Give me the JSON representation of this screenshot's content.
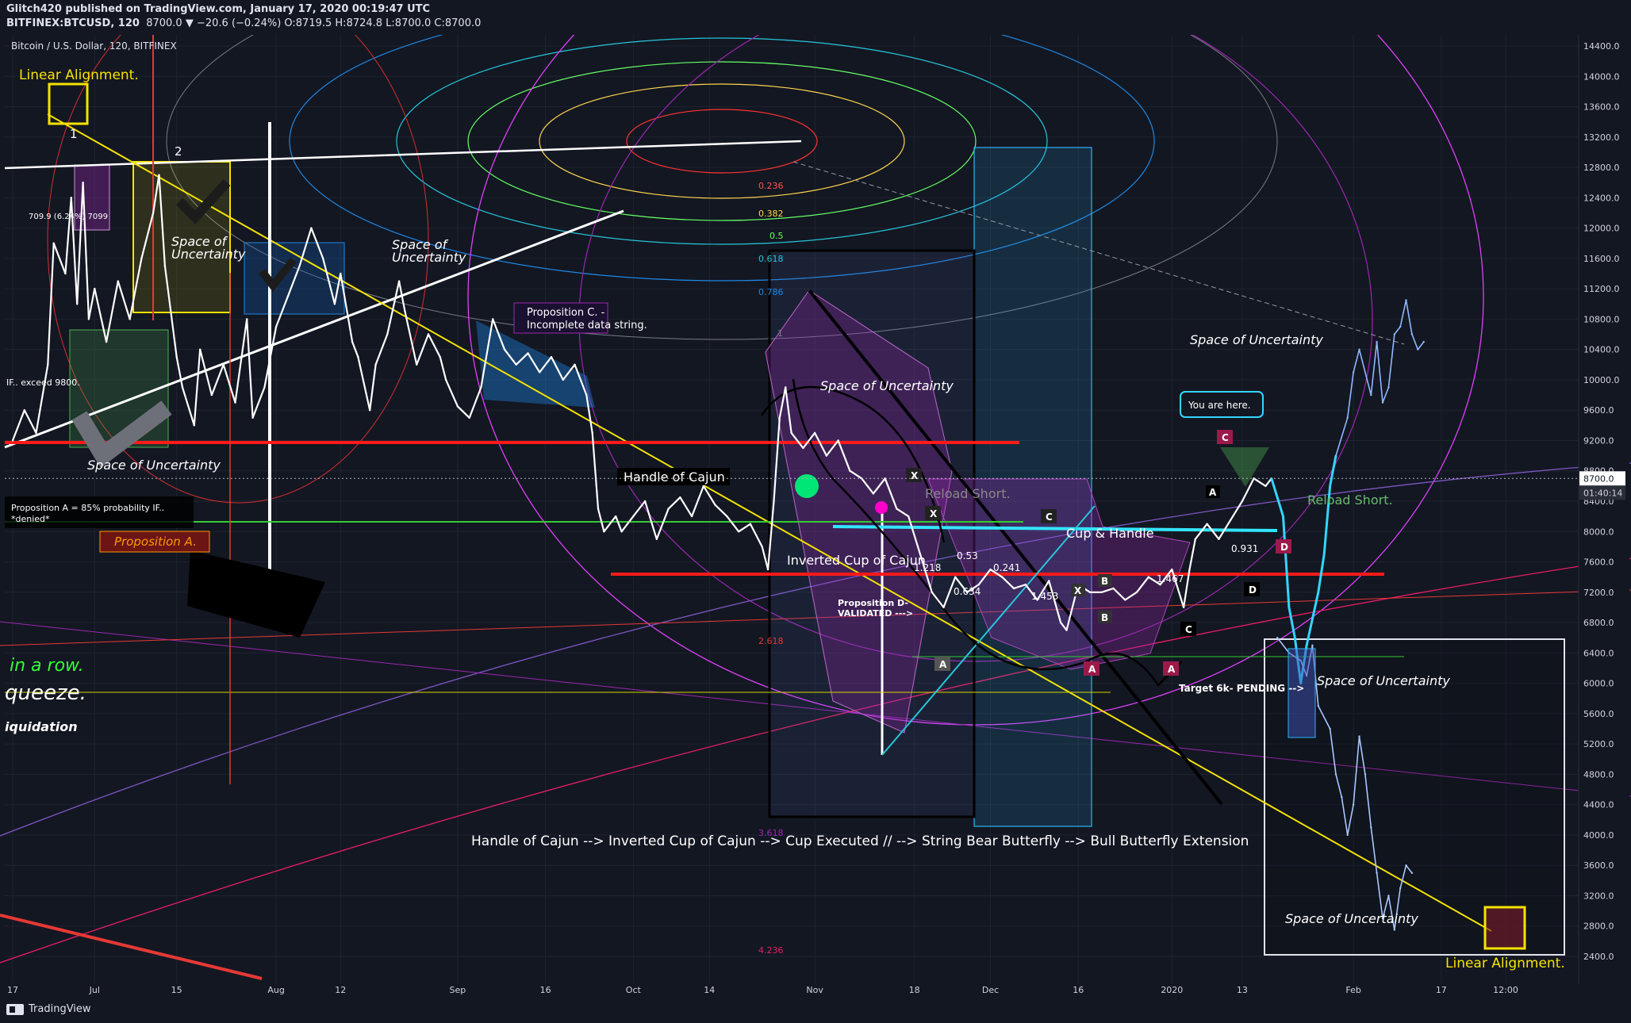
{
  "header": {
    "publish_line": "Glitch420 published on TradingView.com, January 17, 2020 00:19:47 UTC",
    "symbol": "BITFINEX:BTCUSD, 120",
    "ohlc_text": "8700.0 ▼ −20.6 (−0.24%) O:8719.5 H:8724.8 L:8700.0 C:8700.0",
    "legend_title": "Bitcoin / U.S. Dollar, 120, BITFINEX"
  },
  "footer": {
    "brand": "TradingView"
  },
  "colors": {
    "bg": "#131722",
    "grid": "#2a2e39",
    "price": "#ffffff",
    "accent_yellow": "#f5e300",
    "red": "#ff1a1a",
    "cyan": "#33d6ff",
    "purple": "#9c27b0",
    "green": "#33ff33",
    "blue_candle": "#3d7bff"
  },
  "chart_data": {
    "type": "line",
    "title": "Bitcoin / U.S. Dollar, 120, BITFINEX",
    "xlabel": "",
    "ylabel": "",
    "ylim": [
      2200,
      14700
    ],
    "y_ticks": [
      2400,
      2800,
      3200,
      3600,
      4000,
      4400,
      4800,
      5200,
      5600,
      6000,
      6400,
      6800,
      7200,
      7600,
      8000,
      8400,
      8800,
      9200,
      9600,
      10000,
      10400,
      10800,
      11200,
      11600,
      12000,
      12400,
      12800,
      13200,
      13600,
      14000,
      14400
    ],
    "x_ticks": [
      {
        "t": 0,
        "label": "17"
      },
      {
        "t": 14,
        "label": "Jul"
      },
      {
        "t": 28,
        "label": "15"
      },
      {
        "t": 45,
        "label": "Aug"
      },
      {
        "t": 56,
        "label": "12"
      },
      {
        "t": 76,
        "label": "Sep"
      },
      {
        "t": 91,
        "label": "16"
      },
      {
        "t": 106,
        "label": "Oct"
      },
      {
        "t": 119,
        "label": "14"
      },
      {
        "t": 137,
        "label": "Nov"
      },
      {
        "t": 154,
        "label": "18"
      },
      {
        "t": 167,
        "label": "Dec"
      },
      {
        "t": 182,
        "label": "16"
      },
      {
        "t": 198,
        "label": "2020"
      },
      {
        "t": 210,
        "label": "13"
      },
      {
        "t": 229,
        "label": "Feb"
      },
      {
        "t": 244,
        "label": "17"
      },
      {
        "t": 255,
        "label": "12:00"
      }
    ],
    "last_price": 8700.0,
    "countdown": "01:40:14",
    "series": [
      {
        "values": [
          [
            0,
            9200
          ],
          [
            2,
            9600
          ],
          [
            4,
            9300
          ],
          [
            6,
            10200
          ],
          [
            7,
            11800
          ],
          [
            9,
            11400
          ],
          [
            10,
            12400
          ],
          [
            11,
            11000
          ],
          [
            12,
            12600
          ],
          [
            13,
            10800
          ],
          [
            14,
            11200
          ],
          [
            16,
            10500
          ],
          [
            18,
            11300
          ],
          [
            20,
            10800
          ],
          [
            22,
            11600
          ],
          [
            24,
            12200
          ],
          [
            25,
            12700
          ],
          [
            26,
            11500
          ],
          [
            28,
            10300
          ],
          [
            29,
            9900
          ],
          [
            31,
            9400
          ],
          [
            32,
            10400
          ],
          [
            34,
            9800
          ],
          [
            36,
            10200
          ],
          [
            38,
            9700
          ],
          [
            40,
            10800
          ],
          [
            41,
            9500
          ],
          [
            43,
            9900
          ],
          [
            45,
            10700
          ],
          [
            47,
            11100
          ],
          [
            49,
            11500
          ],
          [
            51,
            12000
          ],
          [
            53,
            11600
          ],
          [
            55,
            11000
          ],
          [
            56,
            11400
          ],
          [
            58,
            10500
          ],
          [
            59,
            10300
          ],
          [
            61,
            9600
          ],
          [
            62,
            10200
          ],
          [
            64,
            10600
          ],
          [
            66,
            11300
          ],
          [
            67,
            10900
          ],
          [
            69,
            10200
          ],
          [
            71,
            10600
          ],
          [
            73,
            10300
          ],
          [
            74,
            10000
          ],
          [
            76,
            9650
          ],
          [
            78,
            9500
          ],
          [
            80,
            9900
          ],
          [
            82,
            10800
          ],
          [
            84,
            10400
          ],
          [
            86,
            10200
          ],
          [
            88,
            10350
          ],
          [
            90,
            10100
          ],
          [
            92,
            10300
          ],
          [
            94,
            10000
          ],
          [
            96,
            10200
          ],
          [
            98,
            9800
          ],
          [
            99,
            9300
          ],
          [
            100,
            8300
          ],
          [
            101,
            8000
          ],
          [
            103,
            8200
          ],
          [
            104,
            8000
          ],
          [
            106,
            8200
          ],
          [
            108,
            8400
          ],
          [
            110,
            7900
          ],
          [
            112,
            8300
          ],
          [
            114,
            8450
          ],
          [
            116,
            8200
          ],
          [
            118,
            8600
          ],
          [
            120,
            8350
          ],
          [
            122,
            8200
          ],
          [
            124,
            8000
          ],
          [
            126,
            8100
          ],
          [
            128,
            7800
          ],
          [
            129,
            7500
          ],
          [
            130,
            8400
          ],
          [
            131,
            9500
          ],
          [
            132,
            9900
          ],
          [
            133,
            9300
          ],
          [
            135,
            9100
          ],
          [
            137,
            9300
          ],
          [
            139,
            9000
          ],
          [
            141,
            9200
          ],
          [
            143,
            8800
          ],
          [
            145,
            8700
          ],
          [
            147,
            8500
          ],
          [
            149,
            8700
          ],
          [
            151,
            8300
          ],
          [
            153,
            8200
          ],
          [
            155,
            7700
          ],
          [
            157,
            7200
          ],
          [
            159,
            7000
          ],
          [
            161,
            7400
          ],
          [
            163,
            7200
          ],
          [
            165,
            7300
          ],
          [
            167,
            7500
          ],
          [
            169,
            7400
          ],
          [
            171,
            7250
          ],
          [
            173,
            7300
          ],
          [
            175,
            7100
          ],
          [
            177,
            7350
          ],
          [
            179,
            6800
          ],
          [
            180,
            6700
          ],
          [
            182,
            7300
          ],
          [
            184,
            7200
          ],
          [
            186,
            7200
          ],
          [
            188,
            7250
          ],
          [
            190,
            7100
          ],
          [
            192,
            7200
          ],
          [
            194,
            7400
          ],
          [
            196,
            7300
          ],
          [
            198,
            7500
          ],
          [
            200,
            7000
          ],
          [
            201,
            7500
          ],
          [
            202,
            7900
          ],
          [
            204,
            8100
          ],
          [
            206,
            7900
          ],
          [
            208,
            8150
          ],
          [
            210,
            8400
          ],
          [
            212,
            8700
          ],
          [
            214,
            8600
          ],
          [
            215,
            8700
          ]
        ]
      },
      {
        "values": [
          [
            215,
            8700
          ],
          [
            217,
            8200
          ],
          [
            218,
            7000
          ],
          [
            219,
            6600
          ],
          [
            220,
            6000
          ],
          [
            221,
            6500
          ],
          [
            223,
            7200
          ],
          [
            224,
            7700
          ],
          [
            225,
            8600
          ],
          [
            226,
            9000
          ]
        ]
      },
      {
        "values": [
          [
            226,
            9000
          ],
          [
            228,
            9500
          ],
          [
            229,
            10100
          ],
          [
            230,
            10400
          ],
          [
            232,
            9800
          ],
          [
            233,
            10500
          ],
          [
            234,
            9700
          ],
          [
            235,
            9900
          ],
          [
            236,
            10600
          ],
          [
            237,
            10700
          ],
          [
            238,
            11050
          ],
          [
            239,
            10600
          ],
          [
            240,
            10400
          ],
          [
            241,
            10500
          ]
        ]
      },
      {
        "values": [
          [
            216,
            6600
          ],
          [
            218,
            6400
          ],
          [
            220,
            6300
          ],
          [
            221,
            6100
          ],
          [
            222,
            6500
          ],
          [
            223,
            5700
          ],
          [
            225,
            5400
          ],
          [
            226,
            4800
          ],
          [
            227,
            4500
          ],
          [
            228,
            4000
          ],
          [
            229,
            4400
          ],
          [
            230,
            5300
          ],
          [
            231,
            4800
          ],
          [
            232,
            4100
          ],
          [
            233,
            3500
          ],
          [
            234,
            2900
          ],
          [
            235,
            3200
          ],
          [
            236,
            2750
          ],
          [
            237,
            3300
          ],
          [
            238,
            3600
          ],
          [
            239,
            3500
          ]
        ]
      }
    ]
  },
  "annotations": {
    "linear_alignment_top": "Linear Alignment.",
    "linear_alignment_bottom": "Linear Alignment.",
    "num_1": "1",
    "num_2": "2",
    "fib_709": "709.9 (6.24%) 7099",
    "space_1": "Space of Uncertainty",
    "space_2_a": "Space of",
    "space_2_b": "Uncertainty",
    "space_3_a": "Space of",
    "space_3_b": "Uncertainty",
    "space_4": "Space of Uncertainty",
    "space_5": "Space of Uncertainty",
    "space_6": "Space of Uncertainty",
    "space_7": "Space of Uncertainty",
    "prop_c_a": "Proposition C. -",
    "prop_c_b": "Incomplete data string.",
    "if_exceed": "IF.. exceed 9800.",
    "prop_a_text_a": "Proposition A = 85% probability IF..",
    "prop_a_text_b": "*denied*",
    "prop_a_label": "Proposition A.",
    "in_a_row": "in a row.",
    "squeeze": "queeze.",
    "liquidation": "iquidation",
    "handle_of_cajun": "Handle of Cajun",
    "inverted_cup": "Inverted Cup of Cajun",
    "prop_d_a": "Proposition D-",
    "prop_d_b": "VALIDATED --->",
    "cup_handle": "Cup &  Handle",
    "reload_short_1": "Reload Short.",
    "reload_short_2": "Reload Short.",
    "you_are_here": "You are here.",
    "target_6k": "Target 6k- PENDING -->",
    "sequence": "Handle of Cajun --> Inverted Cup of Cajun --> Cup Executed // --> String Bear Butterfly -->  Bull Butterfly Extension",
    "fib_0236": "0.236",
    "fib_0382": "0.382",
    "fib_05": "0.5",
    "fib_0618": "0.618",
    "fib_0786": "0.786",
    "fib_1": "1",
    "fib_2618": "2.618",
    "fib_3618": "3.618",
    "fib_4236": "4.236",
    "pt_x1": "X",
    "pt_x2": "X",
    "pt_a1": "A",
    "pt_c1": "C",
    "pt_c2": "C",
    "pt_c3": "C",
    "pt_a2": "A",
    "pt_b1": "B",
    "pt_d1": "D",
    "pt_d2": "D",
    "pt_a3": "A",
    "pt_x3": "X",
    "pt_b2": "B",
    "pt_a4": "A",
    "r_053": "0.53",
    "r_0241": "0.241",
    "r_1467": "1.467",
    "r_1218": "1.218",
    "r_0931": "0.931",
    "r_0634": "0.634",
    "r_1453": "1.453"
  }
}
